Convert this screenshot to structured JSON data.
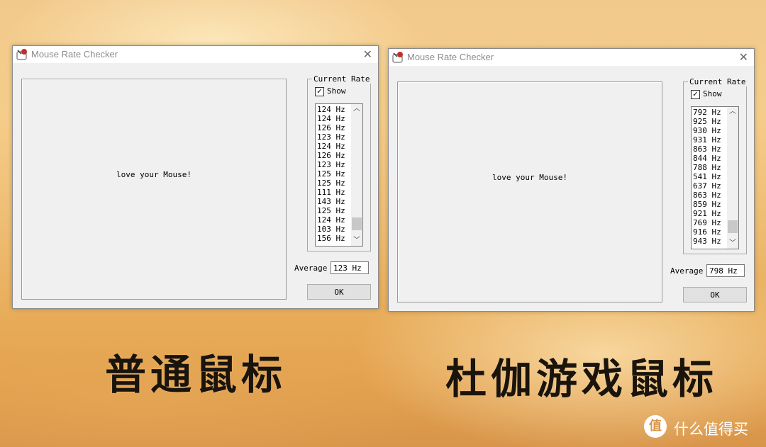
{
  "windows": [
    {
      "title": "Mouse Rate Checker",
      "close": "✕",
      "canvas_text": "love your Mouse!",
      "group_label": "Current Rate",
      "show_label": "Show",
      "show_checked": "✓",
      "rates": [
        "124 Hz",
        "124 Hz",
        "126 Hz",
        "123 Hz",
        "124 Hz",
        "126 Hz",
        "123 Hz",
        "125 Hz",
        "125 Hz",
        "111 Hz",
        "143 Hz",
        "125 Hz",
        "124 Hz",
        "103 Hz",
        "156 Hz"
      ],
      "average_label": "Average",
      "average_value": "123 Hz",
      "ok_label": "OK"
    },
    {
      "title": "Mouse Rate Checker",
      "close": "✕",
      "canvas_text": "love your Mouse!",
      "group_label": "Current Rate",
      "show_label": "Show",
      "show_checked": "✓",
      "rates": [
        "792 Hz",
        "925 Hz",
        "930 Hz",
        "931 Hz",
        "863 Hz",
        "844 Hz",
        "788 Hz",
        "541 Hz",
        "637 Hz",
        "863 Hz",
        "859 Hz",
        "921 Hz",
        "769 Hz",
        "916 Hz",
        "943 Hz"
      ],
      "average_label": "Average",
      "average_value": "798 Hz",
      "ok_label": "OK"
    }
  ],
  "captions": {
    "left": "普通鼠标",
    "right": "杜伽游戏鼠标"
  },
  "watermark": {
    "logo": "值",
    "text": "什么值得买"
  },
  "icons": {
    "app": "mouse-app-icon",
    "close": "close-icon",
    "scroll_up": "chevron-up-icon",
    "scroll_down": "chevron-down-icon"
  }
}
